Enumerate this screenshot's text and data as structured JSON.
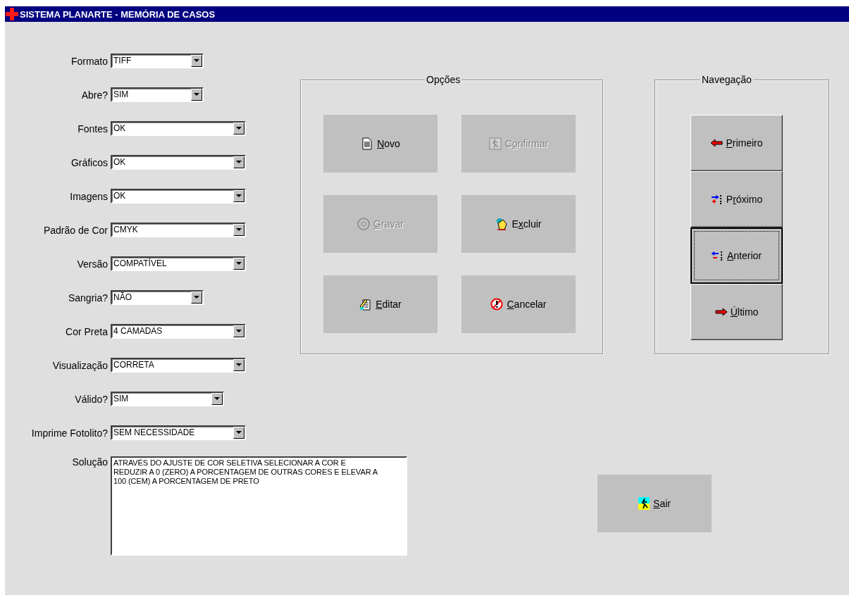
{
  "window": {
    "title": "SISTEMA PLANARTE - MEMÓRIA DE CASOS"
  },
  "fields": [
    {
      "label": "Formato",
      "value": "TIFF"
    },
    {
      "label": "Abre?",
      "value": "SIM"
    },
    {
      "label": "Fontes",
      "value": "OK"
    },
    {
      "label": "Gráficos",
      "value": "OK"
    },
    {
      "label": "Imagens",
      "value": "OK"
    },
    {
      "label": "Padrão de Cor",
      "value": "CMYK"
    },
    {
      "label": "Versão",
      "value": "COMPATÍVEL"
    },
    {
      "label": "Sangria?",
      "value": "NÃO"
    },
    {
      "label": "Cor Preta",
      "value": "4 CAMADAS"
    },
    {
      "label": "Visualização",
      "value": "CORRETA"
    },
    {
      "label": "Válido?",
      "value": "SIM"
    },
    {
      "label": "Imprime Fotolito?",
      "value": "SEM NECESSIDADE"
    }
  ],
  "solution": {
    "label": "Solução",
    "value": "ATRAVÉS DO AJUSTE DE COR SELETIVA SELECIONAR A COR E REDUZIR A 0 (ZERO) A PORCENTAGEM DE OUTRAS CORES E ELEVAR A 100 (CEM) A PORCENTAGEM DE PRETO"
  },
  "options": {
    "title": "Opções",
    "buttons": [
      {
        "kind": "new",
        "key": "N",
        "post": "ovo",
        "disabled": false
      },
      {
        "kind": "confirm",
        "pre": "C",
        "key": "o",
        "post": "nfirmar",
        "disabled": true
      },
      {
        "kind": "save",
        "key": "G",
        "post": "ravar",
        "disabled": true
      },
      {
        "kind": "delete",
        "pre": "E",
        "key": "x",
        "post": "cluir",
        "disabled": false
      },
      {
        "kind": "edit",
        "key": "E",
        "post": "ditar",
        "disabled": false
      },
      {
        "kind": "cancel",
        "key": "C",
        "post": "ancelar",
        "disabled": false
      }
    ]
  },
  "navigation": {
    "title": "Navegação",
    "buttons": [
      {
        "kind": "first",
        "key": "P",
        "post": "rimeiro",
        "focused": false
      },
      {
        "kind": "next",
        "pre": "P",
        "key": "r",
        "post": "óximo",
        "focused": false
      },
      {
        "kind": "previous",
        "key": "A",
        "post": "nterior",
        "focused": true
      },
      {
        "kind": "last",
        "key": "Ú",
        "post": "ltimo",
        "focused": false
      }
    ]
  },
  "exit": {
    "key": "S",
    "post": "air"
  }
}
